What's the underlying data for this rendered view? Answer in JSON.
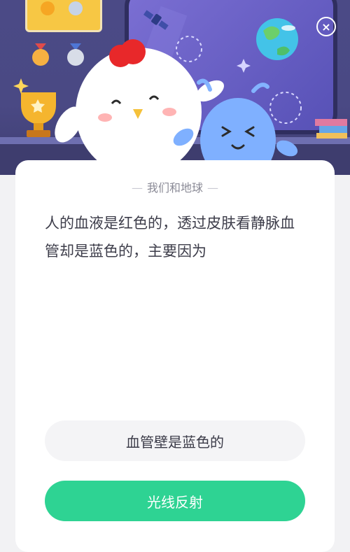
{
  "header": {
    "close_glyph": "×"
  },
  "card": {
    "section_title": "我们和地球",
    "question": "人的血液是红色的，透过皮肤看静脉血管却是蓝色的，主要因为"
  },
  "options": [
    {
      "label": "血管壁是蓝色的"
    },
    {
      "label": "光线反射"
    }
  ],
  "colors": {
    "hero_bg": "#4b4a86",
    "option_default": "#f4f4f6",
    "option_highlight": "#2ed393"
  }
}
